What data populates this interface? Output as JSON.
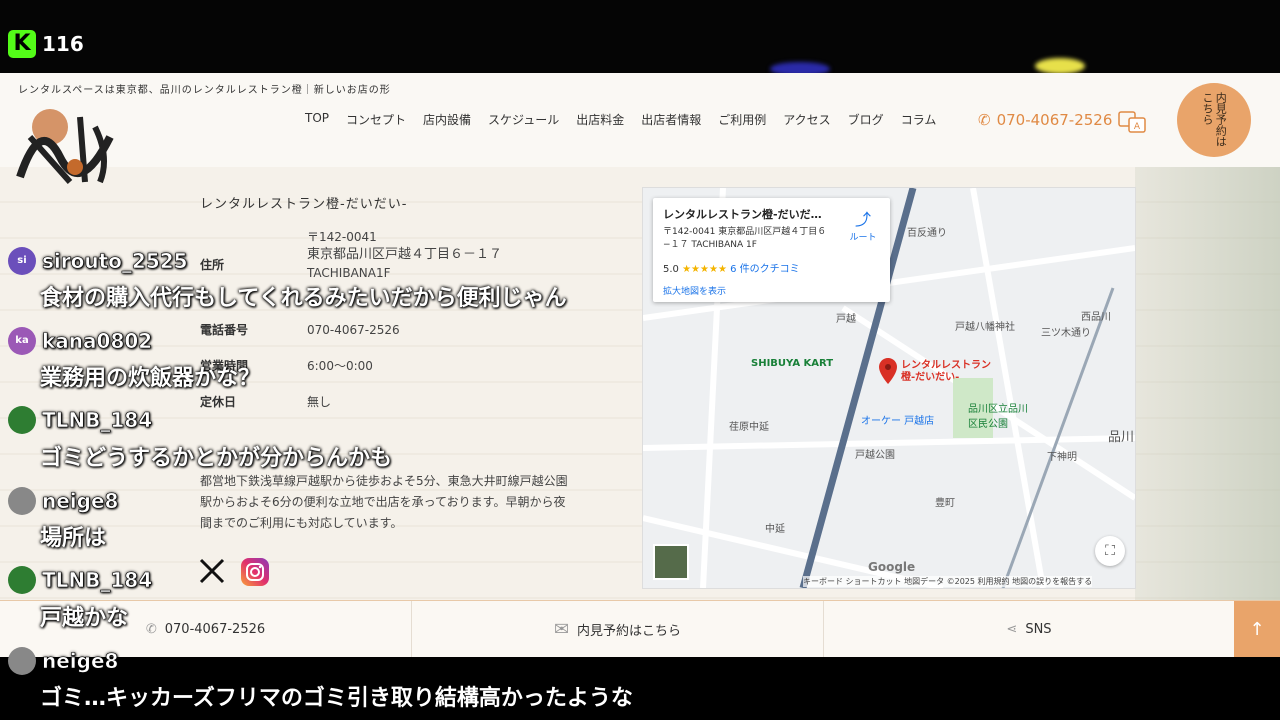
{
  "stream": {
    "viewer_count": "116",
    "platform_logo": "K"
  },
  "site": {
    "tagline": "レンタルスペースは東京都、品川のレンタルレストラン橙｜新しいお店の形",
    "nav": [
      "TOP",
      "コンセプト",
      "店内設備",
      "スケジュール",
      "出店料金",
      "出店者情報",
      "ご利用例",
      "アクセス",
      "ブログ",
      "コラム"
    ],
    "phone": "070-4067-2526",
    "reserve_circle": "内見予約はこちら",
    "shop_title": "レンタルレストラン橙-だいだい-",
    "info": {
      "postal": "〒142-0041",
      "address_label": "住所",
      "address": "東京都品川区戸越４丁目６－１７",
      "building": "TACHIBANA1F",
      "tel_label": "電話番号",
      "tel": "070-4067-2526",
      "hours_label": "営業時間",
      "hours": "6:00〜0:00",
      "holiday_label": "定休日",
      "holiday": "無し"
    },
    "description": "都営地下鉄浅草線戸越駅から徒歩およそ5分、東急大井町線戸越公園駅からおよそ6分の便利な立地で出店を承っております。早朝から夜間までのご利用にも対応しています。",
    "map": {
      "card_title": "レンタルレストラン橙-だいだ…",
      "card_address": "〒142-0041 東京都品川区戸越４丁目６−１７ TACHIBANA 1F",
      "rating": "5.0",
      "stars": "★★★★★",
      "reviews": "6 件のクチコミ",
      "enlarge": "拡大地図を表示",
      "route": "ルート",
      "pin_label": "レンタルレストラン橙-だいだい-",
      "labels": {
        "shibuya_kart": "SHIBUYA KART",
        "okay": "オーケー 戸越店",
        "ebara": "荏原中延",
        "togoshi_koen": "戸越公園",
        "togoshi_hachiman": "戸越八幡神社",
        "shinagawa_park": "品川区立品川区民公園",
        "togoshi": "戸越",
        "toyomachi": "豊町",
        "nakanobu": "中延",
        "shimoshinmei": "下神明",
        "nishishinagawa": "西品川",
        "mitsuki": "三ツ木通り",
        "hyakutan": "百反通り",
        "shinagawa": "品川"
      },
      "google": "Google",
      "footer": "キーボード ショートカット  地図データ ©2025  利用規約  地図の誤りを報告する"
    },
    "bottom_bar": {
      "phone": "070-4067-2526",
      "reserve": "内見予約はこちら",
      "sns": "SNS",
      "top": "↑"
    }
  },
  "chat": [
    {
      "user": "sirouto_2525",
      "initials": "si",
      "color": "#6b4fbb",
      "message": "食材の購入代行もしてくれるみたいだから便利じゃん"
    },
    {
      "user": "kana0802",
      "initials": "ka",
      "color": "#9b59b6",
      "message": "業務用の炊飯器かな？"
    },
    {
      "user": "TLNB_184",
      "initials": "",
      "color": "#2e7d32",
      "message": "ゴミどうするかとかが分からんかも"
    },
    {
      "user": "neige8",
      "initials": "",
      "color": "#888888",
      "message": "場所は"
    },
    {
      "user": "TLNB_184",
      "initials": "",
      "color": "#2e7d32",
      "message": "戸越かな"
    },
    {
      "user": "neige8",
      "initials": "",
      "color": "#888888",
      "message": "ゴミ…キッカーズフリマのゴミ引き取り結構高かったような"
    }
  ],
  "colors": {
    "accent_orange": "#e08a44",
    "kick_green": "#53fc18"
  }
}
